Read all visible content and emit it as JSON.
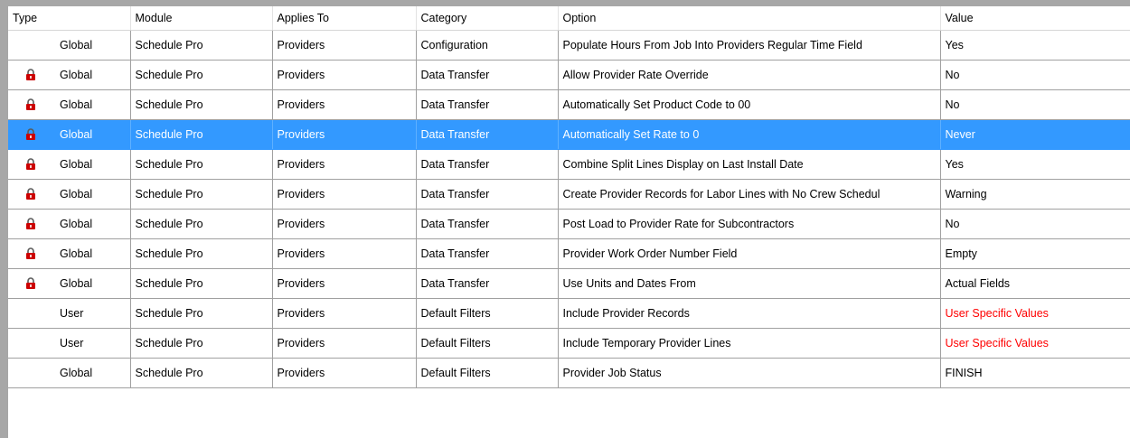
{
  "columns": [
    "Type",
    "Module",
    "Applies To",
    "Category",
    "Option",
    "Value"
  ],
  "colors": {
    "selection": "#3399ff",
    "lock": "#cc0000",
    "user_specific": "#ff0000"
  },
  "rows": [
    {
      "type": "Global",
      "locked": false,
      "module": "Schedule Pro",
      "applies_to": "Providers",
      "category": "Configuration",
      "option": "Populate Hours From Job Into Providers Regular Time Field",
      "value": "Yes",
      "value_style": "normal",
      "selected": false
    },
    {
      "type": "Global",
      "locked": true,
      "module": "Schedule Pro",
      "applies_to": "Providers",
      "category": "Data Transfer",
      "option": "Allow Provider Rate Override",
      "value": "No",
      "value_style": "normal",
      "selected": false
    },
    {
      "type": "Global",
      "locked": true,
      "module": "Schedule Pro",
      "applies_to": "Providers",
      "category": "Data Transfer",
      "option": "Automatically Set Product Code to 00",
      "value": "No",
      "value_style": "normal",
      "selected": false
    },
    {
      "type": "Global",
      "locked": true,
      "module": "Schedule Pro",
      "applies_to": "Providers",
      "category": "Data Transfer",
      "option": "Automatically Set Rate to 0",
      "value": "Never",
      "value_style": "normal",
      "selected": true
    },
    {
      "type": "Global",
      "locked": true,
      "module": "Schedule Pro",
      "applies_to": "Providers",
      "category": "Data Transfer",
      "option": "Combine Split Lines  Display on Last Install Date",
      "value": "Yes",
      "value_style": "normal",
      "selected": false
    },
    {
      "type": "Global",
      "locked": true,
      "module": "Schedule Pro",
      "applies_to": "Providers",
      "category": "Data Transfer",
      "option": "Create Provider Records for Labor Lines with No Crew Schedul",
      "value": "Warning",
      "value_style": "normal",
      "selected": false
    },
    {
      "type": "Global",
      "locked": true,
      "module": "Schedule Pro",
      "applies_to": "Providers",
      "category": "Data Transfer",
      "option": "Post Load to Provider Rate for Subcontractors",
      "value": "No",
      "value_style": "normal",
      "selected": false
    },
    {
      "type": "Global",
      "locked": true,
      "module": "Schedule Pro",
      "applies_to": "Providers",
      "category": "Data Transfer",
      "option": "Provider Work Order Number Field",
      "value": "Empty",
      "value_style": "normal",
      "selected": false
    },
    {
      "type": "Global",
      "locked": true,
      "module": "Schedule Pro",
      "applies_to": "Providers",
      "category": "Data Transfer",
      "option": "Use Units and Dates From",
      "value": "Actual Fields",
      "value_style": "normal",
      "selected": false
    },
    {
      "type": "User",
      "locked": false,
      "module": "Schedule Pro",
      "applies_to": "Providers",
      "category": "Default Filters",
      "option": "Include Provider Records",
      "value": "User Specific Values",
      "value_style": "user-specific",
      "selected": false
    },
    {
      "type": "User",
      "locked": false,
      "module": "Schedule Pro",
      "applies_to": "Providers",
      "category": "Default Filters",
      "option": "Include Temporary Provider Lines",
      "value": "User Specific Values",
      "value_style": "user-specific",
      "selected": false
    },
    {
      "type": "Global",
      "locked": false,
      "module": "Schedule Pro",
      "applies_to": "Providers",
      "category": "Default Filters",
      "option": "Provider Job Status",
      "value": "FINISH",
      "value_style": "normal",
      "selected": false
    }
  ]
}
